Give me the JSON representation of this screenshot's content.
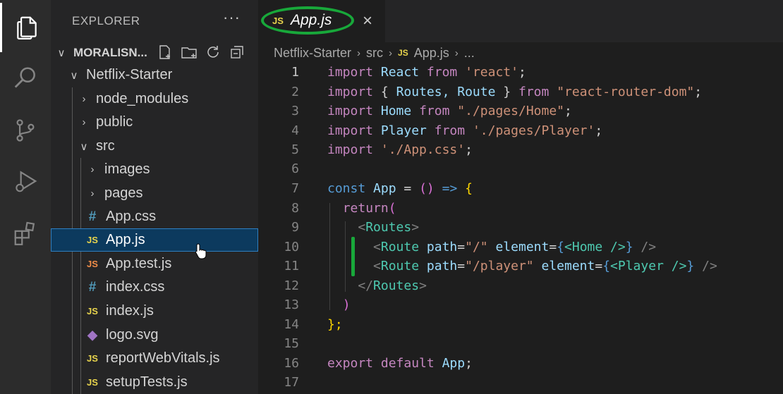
{
  "activity_bar": {
    "items": [
      {
        "name": "files-icon",
        "active": true
      },
      {
        "name": "search-icon",
        "active": false
      },
      {
        "name": "source-control-icon",
        "active": false
      },
      {
        "name": "run-debug-icon",
        "active": false
      },
      {
        "name": "extensions-icon",
        "active": false
      }
    ]
  },
  "sidebar": {
    "title": "EXPLORER",
    "more": "···",
    "root": {
      "label": "MORALISN...",
      "chevron": "∨"
    },
    "project": {
      "label": "Netflix-Starter",
      "chevron": "∨"
    },
    "folders": {
      "node_modules": {
        "label": "node_modules",
        "chevron": "›"
      },
      "public": {
        "label": "public",
        "chevron": "›"
      },
      "src": {
        "label": "src",
        "chevron": "∨"
      },
      "images": {
        "label": "images",
        "chevron": "›"
      },
      "pages": {
        "label": "pages",
        "chevron": "›"
      }
    },
    "files": [
      {
        "label": "App.css",
        "icon": "#"
      },
      {
        "label": "App.js",
        "icon": "JS"
      },
      {
        "label": "App.test.js",
        "icon": "JS"
      },
      {
        "label": "index.css",
        "icon": "#"
      },
      {
        "label": "index.js",
        "icon": "JS"
      },
      {
        "label": "logo.svg",
        "icon": "◆"
      },
      {
        "label": "reportWebVitals.js",
        "icon": "JS"
      },
      {
        "label": "setupTests.js",
        "icon": "JS"
      }
    ],
    "selected_file": "App.js"
  },
  "tabs": [
    {
      "label": "App.js",
      "icon": "JS",
      "close": "×",
      "active": true
    }
  ],
  "breadcrumb": {
    "items": [
      "Netflix-Starter",
      "src",
      "App.js"
    ],
    "file_icon": "JS",
    "separator": "›",
    "tail": "..."
  },
  "editor": {
    "line_numbers": [
      "1",
      "2",
      "3",
      "4",
      "5",
      "6",
      "7",
      "8",
      "9",
      "10",
      "11",
      "12",
      "13",
      "14",
      "15",
      "16",
      "17"
    ],
    "current_line": "1",
    "code": {
      "l1": {
        "kw": "import",
        "id": "React",
        "from": "from",
        "str": "'react'",
        "end": ";"
      },
      "l2": {
        "kw": "import",
        "brace_open": "{",
        "ids": "Routes, Route",
        "brace_close": "}",
        "from": "from",
        "str": "\"react-router-dom\"",
        "end": ";"
      },
      "l3": {
        "kw": "import",
        "id": "Home",
        "from": "from",
        "str": "\"./pages/Home\"",
        "end": ";"
      },
      "l4": {
        "kw": "import",
        "id": "Player",
        "from": "from",
        "str": "'./pages/Player'",
        "end": ";"
      },
      "l5": {
        "kw": "import",
        "str": "'./App.css'",
        "end": ";"
      },
      "l7": {
        "kw": "const",
        "id": "App",
        "op": "=",
        "parens": "()",
        "arrow": "=>",
        "brace": "{"
      },
      "l8": {
        "kw": "return",
        "paren": "("
      },
      "l9": {
        "open": "<",
        "tag": "Routes",
        "close": ">"
      },
      "l10": {
        "open": "<",
        "tag": "Route",
        "attr1": "path",
        "eq1": "=",
        "val1": "\"/\"",
        "attr2": "element",
        "eq2": "=",
        "brace_open": "{",
        "inner": "<Home />",
        "brace_close": "}",
        "end": "/>"
      },
      "l11": {
        "open": "<",
        "tag": "Route",
        "attr1": "path",
        "eq1": "=",
        "val1": "\"/player\"",
        "attr2": "element",
        "eq2": "=",
        "brace_open": "{",
        "inner": "<Player />",
        "brace_close": "}",
        "end": "/>"
      },
      "l12": {
        "open": "</",
        "tag": "Routes",
        "close": ">"
      },
      "l13": {
        "paren": ")"
      },
      "l14": {
        "text": "};"
      },
      "l16": {
        "kw": "export",
        "kw2": "default",
        "id": "App",
        "end": ";"
      }
    }
  },
  "annotations": {
    "highlight_color": "#18a83a"
  }
}
